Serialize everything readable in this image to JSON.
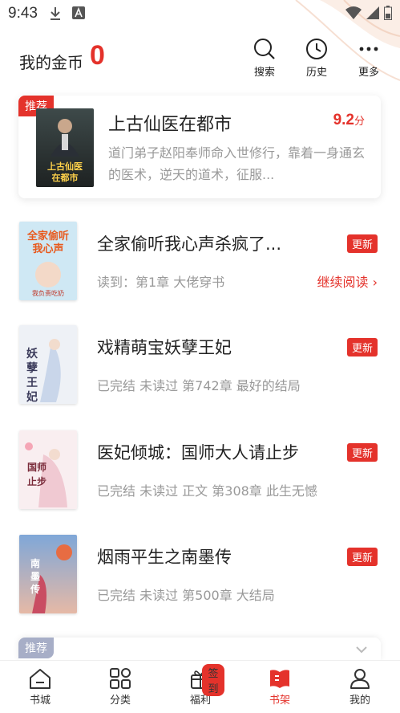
{
  "status": {
    "time": "9:43"
  },
  "header": {
    "coins_label": "我的金币",
    "coins_value": "0",
    "actions": [
      {
        "label": "搜索",
        "icon": "search-icon"
      },
      {
        "label": "历史",
        "icon": "clock-icon"
      },
      {
        "label": "更多",
        "icon": "more-icon"
      }
    ]
  },
  "recommend": {
    "badge": "推荐",
    "title": "上古仙医在都市",
    "score": "9.2",
    "score_unit": "分",
    "description": "道门弟子赵阳奉师命入世修行，靠着一身通玄的医术，逆天的道术，征服...",
    "cover_text": "上古仙医在都市"
  },
  "books": [
    {
      "title": "全家偷听我心声杀疯了...",
      "badge": "更新",
      "info": "读到：第1章 大佬穿书",
      "continue": "继续阅读 ›",
      "cover_text": "全家偷听我心声"
    },
    {
      "title": "戏精萌宝妖孽王妃",
      "badge": "更新",
      "info": "已完结 未读过 第742章  最好的结局",
      "cover_text": "妖孽王妃"
    },
    {
      "title": "医妃倾城：国师大人请止步",
      "badge": "更新",
      "info": "已完结 未读过 正文 第308章 此生无憾",
      "cover_text": "国师止步"
    },
    {
      "title": "烟雨平生之南墨传",
      "badge": "更新",
      "info": "已完结 未读过 第500章 大结局",
      "cover_text": "南墨传"
    }
  ],
  "recommend2": {
    "badge": "推荐"
  },
  "tabs": [
    {
      "label": "书城",
      "icon": "home-icon"
    },
    {
      "label": "分类",
      "icon": "grid-icon"
    },
    {
      "label": "福利",
      "icon": "gift-icon",
      "dot": "签到"
    },
    {
      "label": "书架",
      "icon": "bookshelf-icon",
      "active": true
    },
    {
      "label": "我的",
      "icon": "user-icon"
    }
  ],
  "colors": {
    "accent": "#e4322b",
    "muted": "#999999",
    "badge2": "#a7aec7"
  }
}
